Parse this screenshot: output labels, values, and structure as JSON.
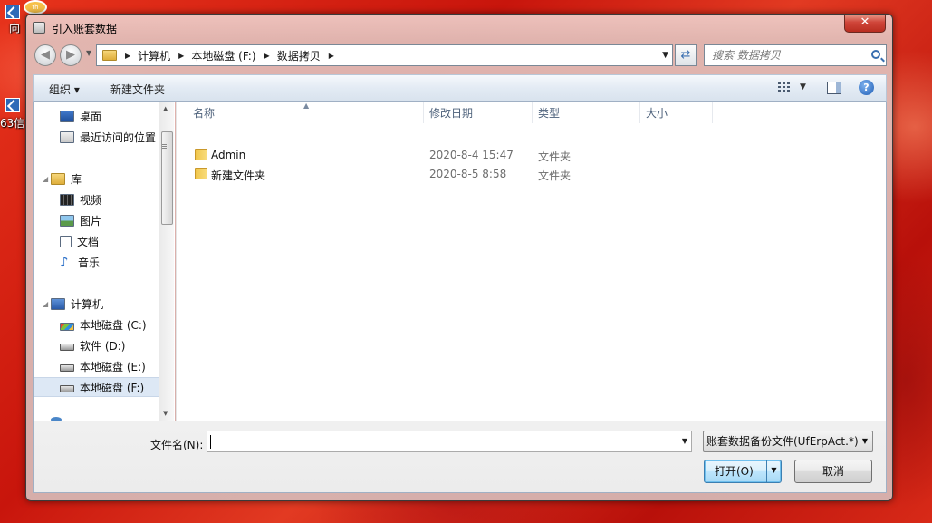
{
  "desktop": {
    "icon1_label": "向",
    "icon2_label": "63信",
    "badge_text": "th"
  },
  "dialog": {
    "title": "引入账套数据",
    "close_label": "✕"
  },
  "address": {
    "breadcrumbs": [
      "计算机",
      "本地磁盘 (F:)",
      "数据拷贝"
    ],
    "search_placeholder": "搜索 数据拷贝"
  },
  "toolbar": {
    "organize_label": "组织 ▾",
    "new_folder_label": "新建文件夹",
    "help_label": "?"
  },
  "nav": {
    "items": [
      {
        "label": "桌面",
        "icon": "desktop-icon"
      },
      {
        "label": "最近访问的位置",
        "icon": "recent-icon"
      },
      {
        "label": "库",
        "icon": "library-icon"
      },
      {
        "label": "视频",
        "icon": "video-icon"
      },
      {
        "label": "图片",
        "icon": "picture-icon"
      },
      {
        "label": "文档",
        "icon": "document-icon"
      },
      {
        "label": "音乐",
        "icon": "music-icon"
      },
      {
        "label": "计算机",
        "icon": "computer-icon"
      },
      {
        "label": "本地磁盘 (C:)",
        "icon": "system-drive-icon"
      },
      {
        "label": "软件 (D:)",
        "icon": "drive-icon"
      },
      {
        "label": "本地磁盘 (E:)",
        "icon": "drive-icon"
      },
      {
        "label": "本地磁盘 (F:)",
        "icon": "drive-icon",
        "selected": true
      }
    ]
  },
  "files": {
    "columns": [
      "名称",
      "修改日期",
      "类型",
      "大小"
    ],
    "rows": [
      {
        "name": "Admin",
        "date": "2020-8-4 15:47",
        "type": "文件夹",
        "size": ""
      },
      {
        "name": "新建文件夹",
        "date": "2020-8-5 8:58",
        "type": "文件夹",
        "size": ""
      }
    ]
  },
  "bottom": {
    "filename_label": "文件名(N):",
    "filename_value": "",
    "filetype_value": "账套数据备份文件(UfErpAct.*)",
    "open_label": "打开(O)",
    "cancel_label": "取消"
  }
}
